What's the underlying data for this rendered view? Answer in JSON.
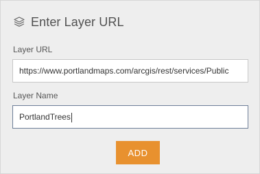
{
  "header": {
    "icon": "layers-icon",
    "title": "Enter Layer URL"
  },
  "form": {
    "url_field": {
      "label": "Layer URL",
      "value": "https://www.portlandmaps.com/arcgis/rest/services/Public"
    },
    "name_field": {
      "label": "Layer Name",
      "value": "PortlandTrees"
    },
    "add_button_label": "ADD"
  },
  "colors": {
    "panel_background": "#eeeeee",
    "accent": "#e8912f",
    "focused_border": "#6c7d97"
  }
}
